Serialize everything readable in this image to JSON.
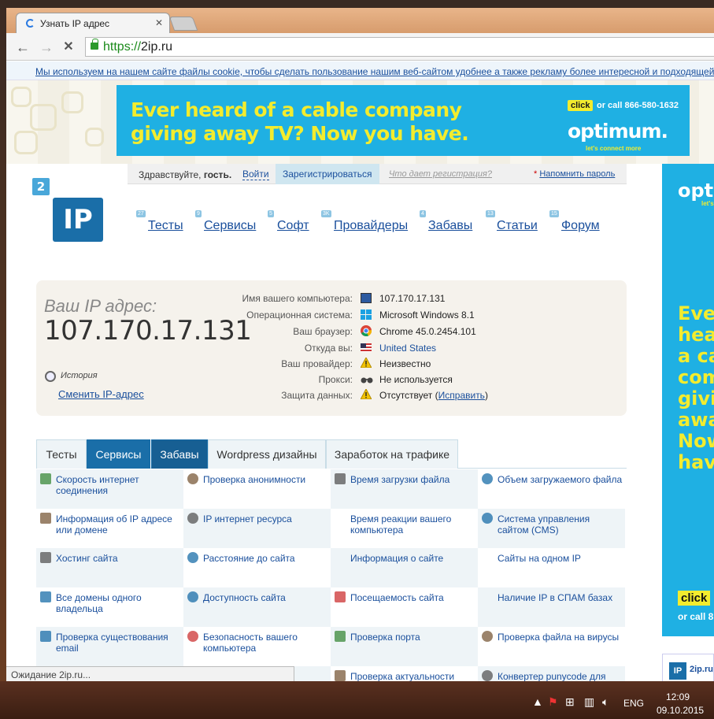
{
  "browser": {
    "tab_title": "Узнать IP адрес",
    "tab_close": "✕",
    "url_scheme": "https://",
    "url_host": "2ip.ru",
    "back": "←",
    "forward": "→",
    "stop": "✕"
  },
  "cookie_notice": "Мы используем на нашем сайте файлы cookie, чтобы сделать пользование нашим веб-сайтом удобнее а также рекламу более интересной и подходящей",
  "banner": {
    "line1": "Ever heard of a cable company",
    "line2": "giving away TV? Now you have.",
    "click": "click",
    "call": "or call 866-580-1632",
    "logo": "optimum.",
    "tagline": "let's connect more"
  },
  "side_ad": {
    "logo": "opti",
    "tagline": "let's",
    "lines": [
      "Eve",
      "hea",
      "a ca",
      "com",
      "givi",
      "awa",
      "Now",
      "have"
    ],
    "click": "click",
    "call": "or call 8"
  },
  "side_footer": {
    "icon": "IP",
    "text": "2ip.ru"
  },
  "login": {
    "hello": "Здравствуйте,",
    "guest": "гость.",
    "login": "Войти",
    "register": "Зарегистрироваться",
    "what": "Что дает регистрация?",
    "forgot_star": "*",
    "forgot": "Напомнить пароль"
  },
  "logo": {
    "small": "2",
    "big": "IP"
  },
  "nav": [
    {
      "label": "Тесты",
      "badge": "27"
    },
    {
      "label": "Сервисы",
      "badge": "9"
    },
    {
      "label": "Софт",
      "badge": "5"
    },
    {
      "label": "Провайдеры",
      "badge": "3K"
    },
    {
      "label": "Забавы",
      "badge": "4"
    },
    {
      "label": "Статьи",
      "badge": "13"
    },
    {
      "label": "Форум",
      "badge": "15"
    }
  ],
  "ipbox": {
    "caption": "Ваш IP адрес:",
    "ip": "107.170.17.131",
    "history": "История",
    "change": "Сменить IP-адрес"
  },
  "info": [
    {
      "label": "Имя вашего компьютера:",
      "value": "107.170.17.131",
      "icon": "computer-icon"
    },
    {
      "label": "Операционная система:",
      "value": "Microsoft Windows 8.1",
      "icon": "windows-icon"
    },
    {
      "label": "Ваш браузер:",
      "value": "Chrome 45.0.2454.101",
      "icon": "chrome-icon"
    },
    {
      "label": "Откуда вы:",
      "value": "United States",
      "icon": "us-flag-icon"
    },
    {
      "label": "Ваш провайдер:",
      "value": "Неизвестно",
      "icon": "warning-icon"
    },
    {
      "label": "Прокси:",
      "value": "Не используется",
      "icon": "glasses-icon"
    },
    {
      "label": "Защита данных:",
      "value": "Отсутствует (",
      "link": "Исправить",
      "suffix": ")",
      "icon": "warning-icon"
    }
  ],
  "section_tabs": [
    "Тесты",
    "Сервисы",
    "Забавы",
    "Wordpress дизайны",
    "Заработок на трафике"
  ],
  "services": [
    [
      "Скорость интернет соединения",
      "Проверка анонимности",
      "Время загрузки файла",
      "Объем загружаемого файла"
    ],
    [
      "Информация об IP адресе или домене",
      "IP интернет ресурса",
      "Время реакции вашего компьютера",
      "Система управления сайтом (CMS)"
    ],
    [
      "Хостинг сайта",
      "Расстояние до сайта",
      "Информация о сайте",
      "Сайты на одном IP"
    ],
    [
      "Все домены одного владельца",
      "Доступность сайта",
      "Посещаемость сайта",
      "Наличие IP в СПАМ базах"
    ],
    [
      "Проверка существования email",
      "Безопасность вашего компьютера",
      "Проверка порта",
      "Проверка файла на вирусы"
    ],
    [
      "",
      "вирусы",
      "Проверка актуальности",
      "Конвертер punycode для"
    ]
  ],
  "status_text": "Ожидание 2ip.ru...",
  "taskbar": {
    "lang": "ENG",
    "time": "12:09",
    "date": "09.10.2015"
  },
  "colors": {
    "accent": "#1a6ea8",
    "link": "#1a4f9c",
    "ad_blue": "#1fb0e3",
    "ad_yellow": "#f3ec2e"
  }
}
